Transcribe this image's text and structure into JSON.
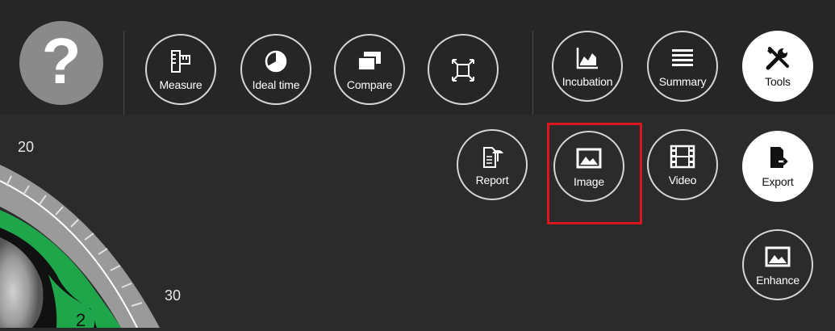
{
  "toolbar": {
    "help_symbol": "?",
    "measure_label": "Measure",
    "ideal_time_label": "Ideal time",
    "compare_label": "Compare",
    "incubation_label": "Incubation",
    "summary_label": "Summary",
    "tools_label": "Tools"
  },
  "export_menu": {
    "report_label": "Report",
    "image_label": "Image",
    "video_label": "Video",
    "export_label": "Export",
    "enhance_label": "Enhance"
  },
  "dial": {
    "label_20": "20",
    "label_30": "30",
    "marker_value": "2"
  },
  "colors": {
    "background": "#2b2b2b",
    "highlight": "#d9161d",
    "dial_green": "#1fa64a"
  }
}
